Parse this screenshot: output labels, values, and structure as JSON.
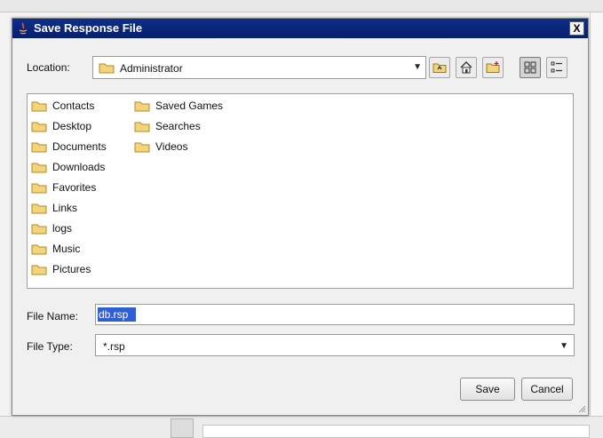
{
  "window": {
    "title": "Save Response File",
    "close_glyph": "X"
  },
  "location": {
    "label": "Location:",
    "value": "Administrator"
  },
  "toolbar": {
    "buttons": [
      "up-one-level-icon",
      "home-icon",
      "new-folder-icon",
      "list-view-icon",
      "details-view-icon"
    ],
    "active": "list-view-icon"
  },
  "files": {
    "column1": [
      "Contacts",
      "Desktop",
      "Documents",
      "Downloads",
      "Favorites",
      "Links",
      "logs",
      "Music",
      "Pictures"
    ],
    "column2": [
      "Saved Games",
      "Searches",
      "Videos"
    ]
  },
  "file_name": {
    "label": "File Name:",
    "value": "db.rsp"
  },
  "file_type": {
    "label": "File Type:",
    "value": "*.rsp"
  },
  "buttons": {
    "save": "Save",
    "cancel": "Cancel"
  },
  "colors": {
    "titlebar": "#0a2a80",
    "selection": "#2f5fd2",
    "folder": "#e8c55a"
  }
}
